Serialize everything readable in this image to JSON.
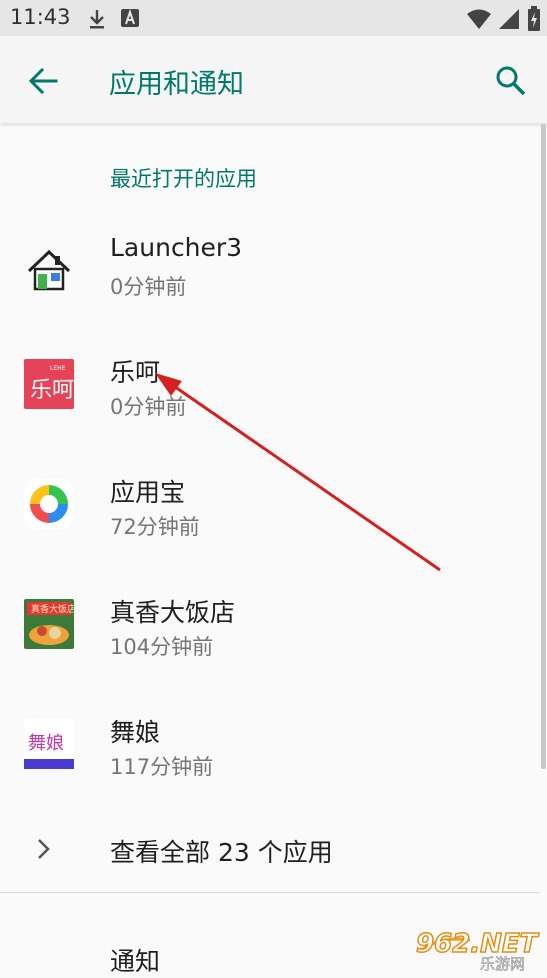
{
  "status_bar": {
    "time": "11:43"
  },
  "header": {
    "title": "应用和通知"
  },
  "recent": {
    "header": "最近打开的应用",
    "apps": [
      {
        "name": "Launcher3",
        "time": "0分钟前"
      },
      {
        "name": "乐呵",
        "time": "0分钟前"
      },
      {
        "name": "应用宝",
        "time": "72分钟前"
      },
      {
        "name": "真香大饭店",
        "time": "104分钟前"
      },
      {
        "name": "舞娘",
        "time": "117分钟前"
      }
    ]
  },
  "see_all": {
    "label": "查看全部 23 个应用"
  },
  "notifications": {
    "label": "通知"
  },
  "watermark": {
    "brand": "962.NET",
    "sub": "乐游网"
  },
  "colors": {
    "accent": "#00796b",
    "annotation_arrow": "#d42020"
  }
}
